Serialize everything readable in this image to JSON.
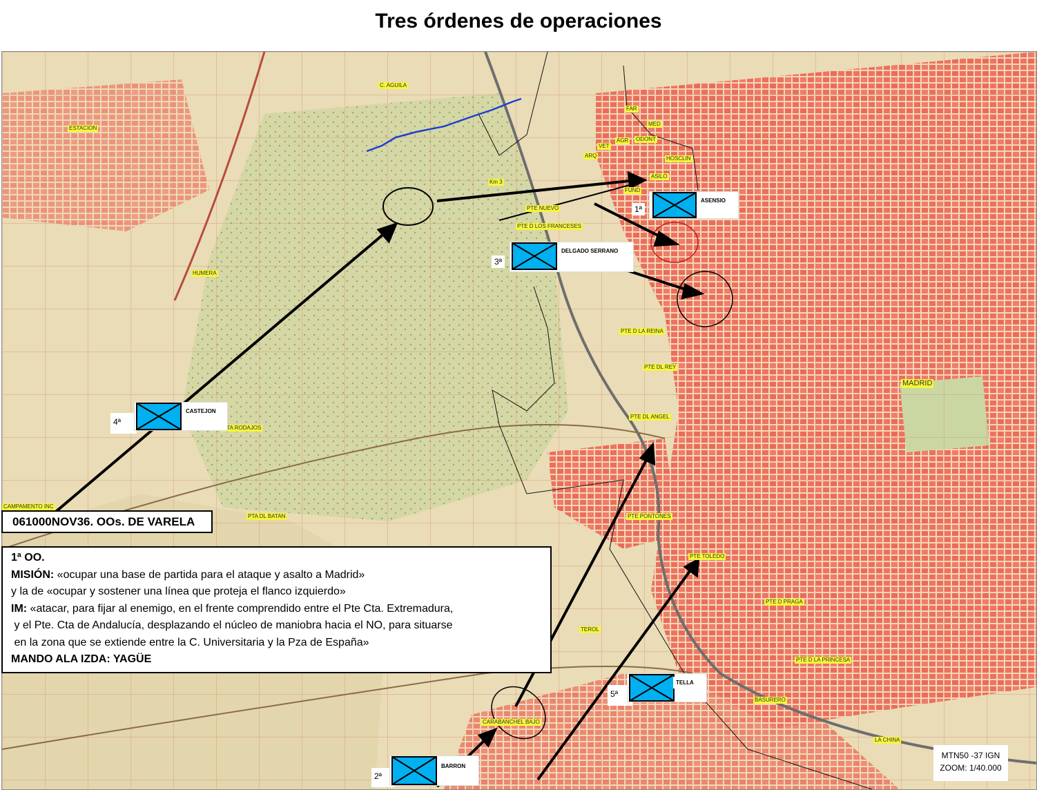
{
  "title": "Tres órdenes de operaciones",
  "map_labels": {
    "estacion": "ESTACION",
    "c_aguila": "C. AGUILA",
    "far": "FAR",
    "med": "MED",
    "odont": "ODONT",
    "vet": "VET",
    "agr": "AGR",
    "arq": "ARQ",
    "hosclin": "HOSCLIN",
    "asilo": "ASILO",
    "fund": "FUND",
    "km3": "Km 3",
    "pte_nuevo": "PTE NUEVO",
    "pte_franceses": "PTE D LOS FRANCESES",
    "humera": "HUMERA",
    "pte_reina": "PTE D LA REINA",
    "pte_rey": "PTE DL REY",
    "pte_angel": "PTE DL ANGEL",
    "madrid": "MADRID",
    "pta_rodajos": "PTA RODAJOS",
    "pta_batan": "PTA DL BATAN",
    "campamento": "CAMPAMENTO INC",
    "pte_pontones": "PTE PONTONES",
    "pte_toledo": "PTE TOLEDO",
    "pte_praga": "PTE D PRAGA",
    "terol": "TEROL",
    "pte_princesa": "PTE D LA PRINCESA",
    "basurero": "BASURERO",
    "la_china": "LA CHINA",
    "carabanchel_bajo": "CARABANCHEL BAJO"
  },
  "units": [
    {
      "num": "1ª",
      "name": "ASENSIO"
    },
    {
      "num": "2ª",
      "name": "BARRON"
    },
    {
      "num": "3ª",
      "name": "DELGADO SERRANO"
    },
    {
      "num": "4ª",
      "name": "CASTEJON"
    },
    {
      "num": "5ª",
      "name": "TELLA"
    }
  ],
  "date_order": "061000NOV36. OOs. DE VARELA",
  "order": {
    "heading": "1ª OO.",
    "mision_label": "MISIÓN:",
    "mision_text": " «ocupar una base de partida para el ataque y asalto a Madrid»",
    "line2": "y la de «ocupar y sostener una línea que proteja el flanco izquierdo»",
    "im_label": "IM:",
    "im_text": " «atacar, para fijar al enemigo, en el frente comprendido entre el Pte Cta. Extremadura,",
    "line4": " y el Pte. Cta de Andalucía, desplazando el núcleo de maniobra hacia el NO, para situarse",
    "line5": " en la zona que se extiende entre la C. Universitaria y la Pza de España»",
    "mando": "MANDO ALA IZDA: YAGÜE"
  },
  "source": {
    "line1": "MTN50 -37 IGN",
    "line2": "ZOOM: 1/40.000"
  },
  "colors": {
    "map_base": "#e9dcb6",
    "urban": "#ee7b6a",
    "vegetation": "#c9d29b",
    "unit_fill": "#00b0f0",
    "label_bg": "#f6f63a",
    "arrow": "#000000",
    "river": "#1f3fd0"
  }
}
